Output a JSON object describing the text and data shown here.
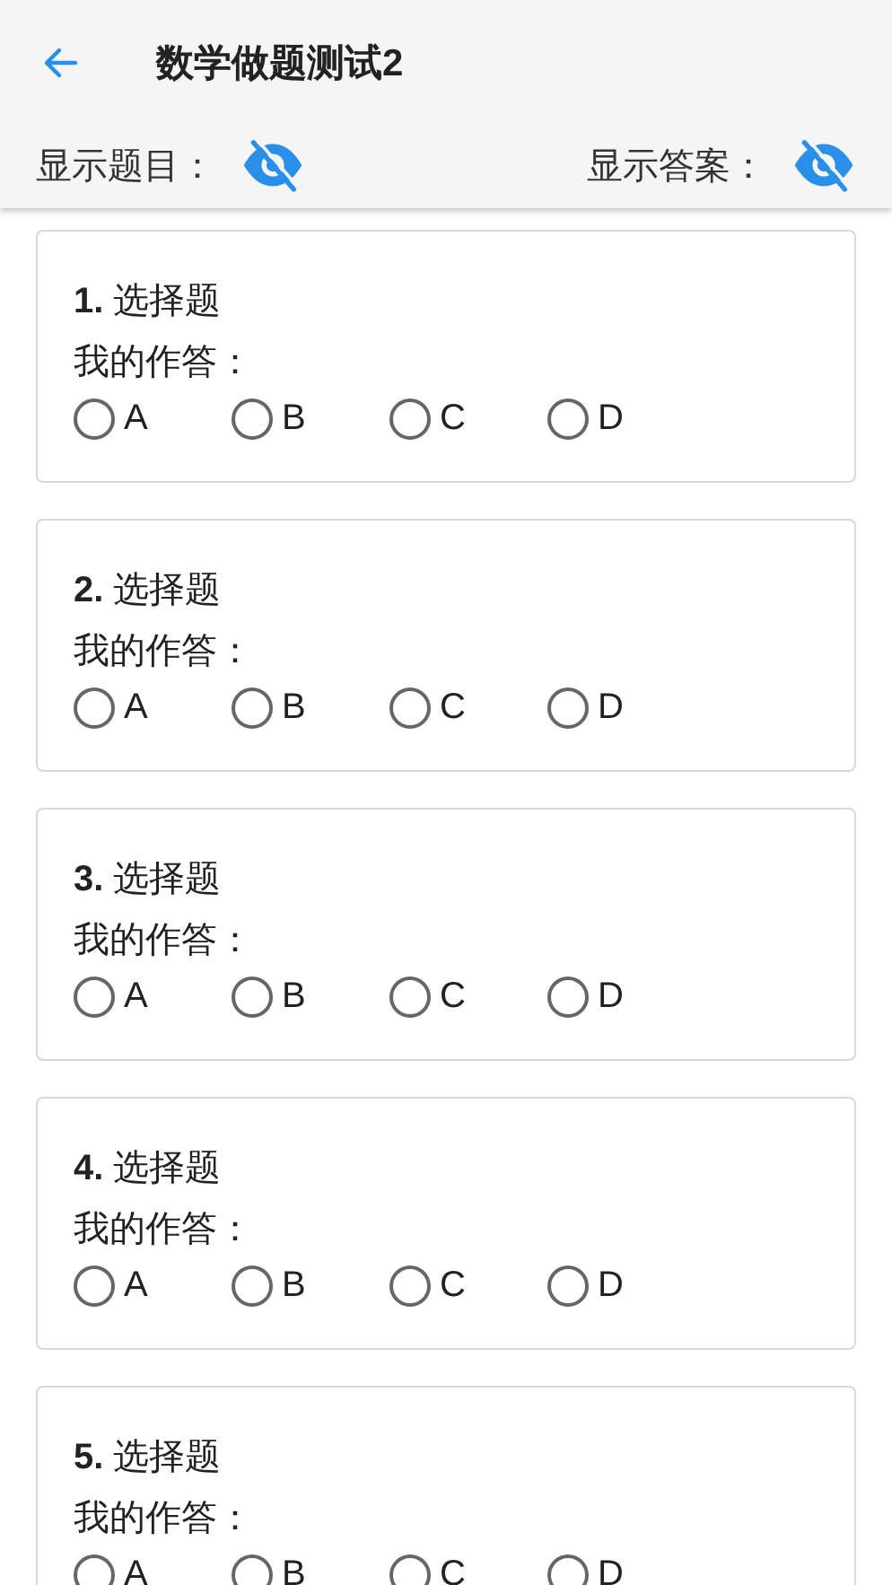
{
  "header": {
    "title": "数学做题测试2"
  },
  "toggles": [
    {
      "label": "显示题目：",
      "on": false
    },
    {
      "label": "显示答案：",
      "on": false
    }
  ],
  "questions": [
    {
      "title": "**1.** 选择题",
      "answer_label": "我的作答：",
      "options": [
        {
          "label": "A",
          "selected": false
        },
        {
          "label": "B",
          "selected": false
        },
        {
          "label": "C",
          "selected": false
        },
        {
          "label": "D",
          "selected": false
        }
      ]
    },
    {
      "title": "**2.** 选择题",
      "answer_label": "我的作答：",
      "options": [
        {
          "label": "A",
          "selected": false
        },
        {
          "label": "B",
          "selected": false
        },
        {
          "label": "C",
          "selected": false
        },
        {
          "label": "D",
          "selected": false
        }
      ]
    },
    {
      "title": "**3.** 选择题",
      "answer_label": "我的作答：",
      "options": [
        {
          "label": "A",
          "selected": false
        },
        {
          "label": "B",
          "selected": false
        },
        {
          "label": "C",
          "selected": false
        },
        {
          "label": "D",
          "selected": false
        }
      ]
    },
    {
      "title": "**4.** 选择题",
      "answer_label": "我的作答：",
      "options": [
        {
          "label": "A",
          "selected": false
        },
        {
          "label": "B",
          "selected": false
        },
        {
          "label": "C",
          "selected": false
        },
        {
          "label": "D",
          "selected": false
        }
      ]
    },
    {
      "title": "**5.** 选择题",
      "answer_label": "我的作答：",
      "options": [
        {
          "label": "A",
          "selected": false
        },
        {
          "label": "B",
          "selected": false
        },
        {
          "label": "C",
          "selected": false
        },
        {
          "label": "D",
          "selected": false
        }
      ]
    }
  ]
}
